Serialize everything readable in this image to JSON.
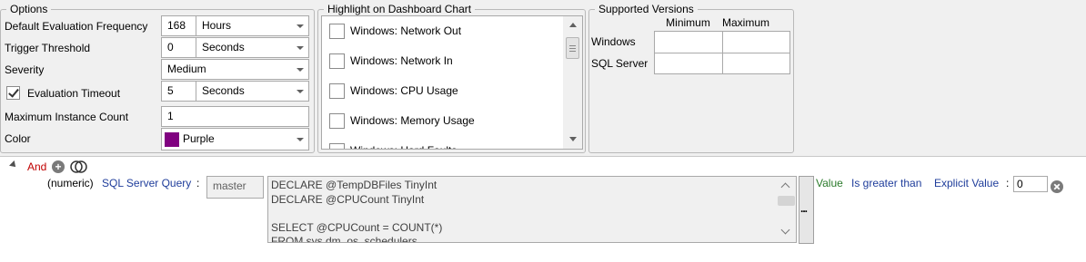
{
  "options": {
    "legend": "Options",
    "rows": {
      "freq": {
        "label": "Default Evaluation Frequency",
        "value": "168",
        "unit": "Hours"
      },
      "trigger": {
        "label": "Trigger Threshold",
        "value": "0",
        "unit": "Seconds"
      },
      "severity": {
        "label": "Severity",
        "value": "Medium"
      },
      "timeout": {
        "label": "Evaluation Timeout",
        "checked": true,
        "value": "5",
        "unit": "Seconds"
      },
      "maxinst": {
        "label": "Maximum Instance Count",
        "value": "1"
      },
      "color": {
        "label": "Color",
        "value": "Purple",
        "swatch": "#800080"
      }
    }
  },
  "highlight": {
    "legend": "Highlight on Dashboard Chart",
    "items": [
      {
        "label": "Windows: Network Out",
        "checked": false
      },
      {
        "label": "Windows: Network In",
        "checked": false
      },
      {
        "label": "Windows: CPU Usage",
        "checked": false
      },
      {
        "label": "Windows: Memory Usage",
        "checked": false
      },
      {
        "label": "Windows: Hard Faults",
        "checked": false
      }
    ]
  },
  "versions": {
    "legend": "Supported Versions",
    "col_min": "Minimum",
    "col_max": "Maximum",
    "row_windows": "Windows",
    "row_sqlserver": "SQL Server"
  },
  "condition": {
    "operator": "And",
    "prefix": "(numeric)",
    "query_label": "SQL Server Query",
    "colon": ":",
    "database": "master",
    "query_lines": [
      "DECLARE @TempDBFiles TinyInt",
      "DECLARE @CPUCount TinyInt",
      "",
      "SELECT @CPUCount = COUNT(*)",
      "FROM sys.dm_os_schedulers"
    ],
    "ellipsis": "...",
    "value_word": "Value",
    "comparator": "Is greater than",
    "explicit": "Explicit Value",
    "explicit_colon": ":",
    "threshold": "0"
  },
  "colors": {
    "purple": "#800080",
    "operator_red": "#c00000",
    "link_blue": "#1f3d9b",
    "value_green": "#2a7a2a"
  }
}
